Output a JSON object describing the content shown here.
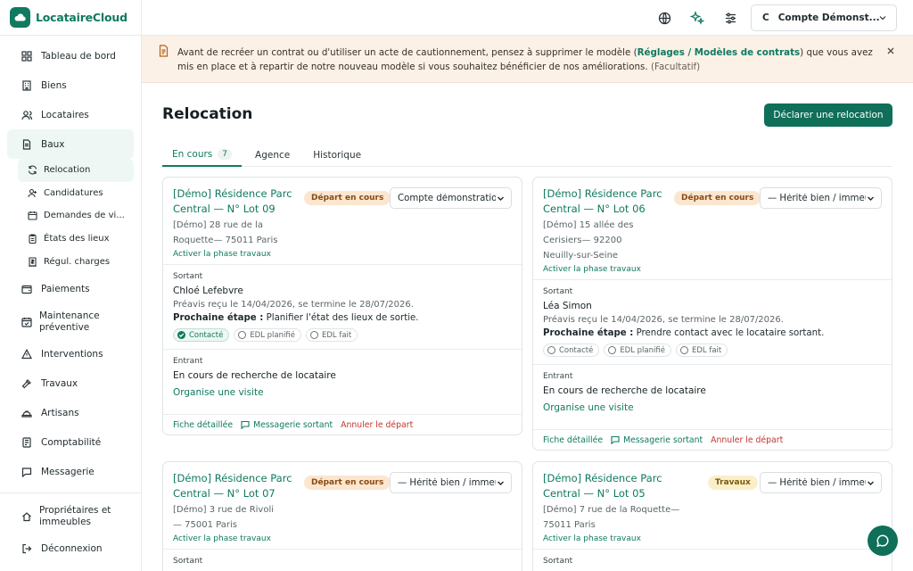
{
  "app": {
    "name": "LocataireCloud"
  },
  "sidebar": {
    "items": [
      {
        "label": "Tableau de bord",
        "icon": "dashboard-icon"
      },
      {
        "label": "Biens",
        "icon": "building-icon"
      },
      {
        "label": "Locataires",
        "icon": "users-icon"
      },
      {
        "label": "Baux",
        "icon": "file-icon"
      }
    ],
    "sub_items": [
      {
        "label": "Relocation",
        "icon": "refresh-icon"
      },
      {
        "label": "Candidatures",
        "icon": "user-plus-icon"
      },
      {
        "label": "Demandes de vi...",
        "icon": "calendar-icon"
      },
      {
        "label": "États des lieux",
        "icon": "clipboard-icon"
      },
      {
        "label": "Régul. charges",
        "icon": "receipt-icon"
      }
    ],
    "items2": [
      {
        "label": "Paiements",
        "icon": "wallet-icon"
      },
      {
        "label": "Maintenance préventive",
        "icon": "calendar-check-icon"
      },
      {
        "label": "Interventions",
        "icon": "alert-icon"
      },
      {
        "label": "Travaux",
        "icon": "hammer-icon"
      },
      {
        "label": "Artisans",
        "icon": "hard-hat-icon"
      },
      {
        "label": "Comptabilité",
        "icon": "ledger-icon"
      },
      {
        "label": "Messagerie",
        "icon": "message-icon"
      }
    ],
    "bottom": [
      {
        "label": "Propriétaires et immeubles",
        "icon": "home-icon"
      },
      {
        "label": "Déconnexion",
        "icon": "logout-icon"
      }
    ]
  },
  "header": {
    "account_initial": "C",
    "account_name": "Compte Démonst..."
  },
  "banner": {
    "text_before": "Avant de recréer un contrat ou d'utiliser un acte de cautionnement, pensez à supprimer le modèle (",
    "link": "Réglages / Modèles de contrats",
    "text_after": ") que vous avez mis en place et à repartir de notre nouveau modèle si vous souhaitez bénéficier de nos améliorations.",
    "optional": "(Facultatif)"
  },
  "page": {
    "title": "Relocation",
    "primary_button": "Déclarer une relocation",
    "tabs": [
      {
        "label": "En cours",
        "count": "7"
      },
      {
        "label": "Agence"
      },
      {
        "label": "Historique"
      }
    ]
  },
  "labels": {
    "sortant": "Sortant",
    "entrant": "Entrant",
    "next_step": "Prochaine étape :",
    "activate_works": "Activer la phase travaux",
    "fiche": "Fiche détaillée",
    "messagerie": "Messagerie sortant",
    "cancel": "Annuler le départ",
    "search_status": "En cours de recherche de locataire",
    "visit_link": "Organise une visite",
    "chip_contact": "Contacté",
    "chip_edl_plan": "EDL planifié",
    "chip_edl_done": "EDL fait"
  },
  "cards": [
    {
      "title": "[Démo] Résidence Parc Central — N° Lot 09",
      "address": "[Démo] 28 rue de la Roquette— 75011 Paris",
      "badge": "Départ en cours",
      "select": "Compte démonstratio",
      "tenant": "Chloé Lefebvre",
      "notice": "Préavis reçu le 14/04/2026, se termine le 28/07/2026.",
      "next_step": "Planifier l'état des lieux de sortie.",
      "contacted": true
    },
    {
      "title": "[Démo] Résidence Parc Central — N° Lot 06",
      "address": "[Démo] 15 allée des Cerisiers— 92200 Neuilly-sur-Seine",
      "badge": "Départ en cours",
      "select": "— Hérité bien / immeu",
      "tenant": "Léa Simon",
      "notice": "Préavis reçu le 14/04/2026, se termine le 28/07/2026.",
      "next_step": "Prendre contact avec le locataire sortant.",
      "contacted": false
    },
    {
      "title": "[Démo] Résidence Parc Central — N° Lot 07",
      "address": "[Démo] 3 rue de Rivoli— 75001 Paris",
      "badge": "Départ en cours",
      "select": "— Hérité bien / immeu"
    },
    {
      "title": "[Démo] Résidence Parc Central — N° Lot 05",
      "address": "[Démo] 7 rue de la Roquette— 75011 Paris",
      "badge": "Travaux",
      "select": "— Hérité bien / immeu"
    }
  ],
  "colors": {
    "brand": "#0f7a5f",
    "danger": "#c0362c",
    "banner_bg": "#fbf1e7"
  }
}
